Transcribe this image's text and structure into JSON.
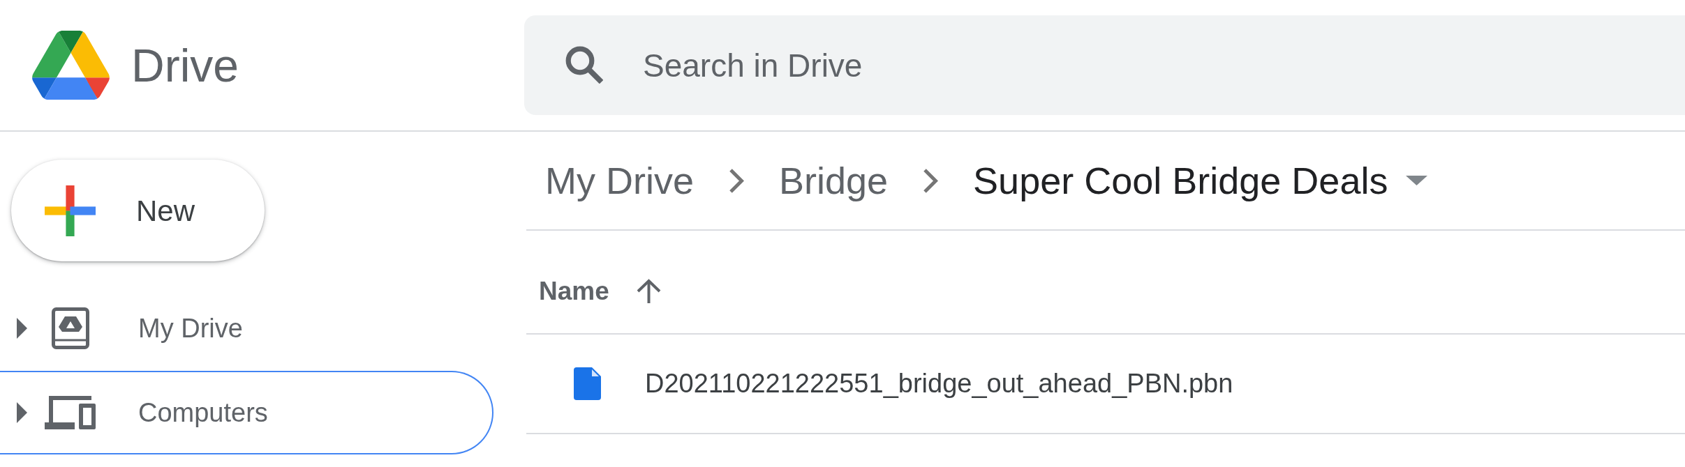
{
  "app": {
    "name": "Drive"
  },
  "search": {
    "placeholder": "Search in Drive"
  },
  "new_button": {
    "label": "New"
  },
  "sidebar": {
    "items": [
      {
        "label": "My Drive",
        "kind": "my_drive",
        "expanded": false,
        "focused": false
      },
      {
        "label": "Computers",
        "kind": "computers",
        "expanded": false,
        "focused": true
      }
    ]
  },
  "breadcrumb": {
    "items": [
      {
        "label": "My Drive",
        "current": false
      },
      {
        "label": "Bridge",
        "current": false
      },
      {
        "label": "Super Cool Bridge Deals",
        "current": true
      }
    ]
  },
  "file_list": {
    "columns": [
      {
        "label": "Name",
        "sorted_ascending": true
      }
    ],
    "rows": [
      {
        "name": "D202110221222551_bridge_out_ahead_PBN.pbn",
        "kind": "file"
      }
    ]
  }
}
